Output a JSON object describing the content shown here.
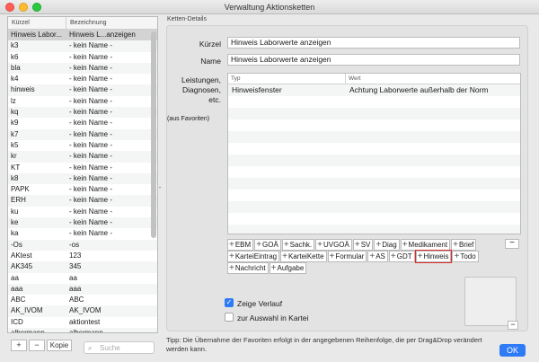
{
  "window": {
    "title": "Verwaltung Aktionsketten"
  },
  "list": {
    "columns": [
      "Kürzel",
      "Bezeichnung"
    ],
    "rows": [
      [
        "Hinweis Labor...",
        "Hinweis L...anzeigen"
      ],
      [
        "k3",
        "- kein Name -"
      ],
      [
        "k6",
        "- kein Name -"
      ],
      [
        "bla",
        "- kein Name -"
      ],
      [
        "k4",
        "- kein Name -"
      ],
      [
        "hinweis",
        "- kein Name -"
      ],
      [
        "lz",
        "- kein Name -"
      ],
      [
        "kq",
        "- kein Name -"
      ],
      [
        "k9",
        "- kein Name -"
      ],
      [
        "k7",
        "- kein Name -"
      ],
      [
        "k5",
        "- kein Name -"
      ],
      [
        "kr",
        "- kein Name -"
      ],
      [
        "KT",
        "- kein Name -"
      ],
      [
        "k8",
        "- kein Name -"
      ],
      [
        "PAPK",
        "- kein Name -"
      ],
      [
        "ERH",
        "- kein Name -"
      ],
      [
        "ku",
        "- kein Name -"
      ],
      [
        "ke",
        "- kein Name -"
      ],
      [
        "ka",
        "- kein Name -"
      ],
      [
        "-Os",
        "-os"
      ],
      [
        "AKtest",
        "123"
      ],
      [
        "AK345",
        "345"
      ],
      [
        "aa",
        "aa"
      ],
      [
        "aaa",
        "aaa"
      ],
      [
        "ABC",
        "ABC"
      ],
      [
        "AK_IVOM",
        "AK_IVOM"
      ],
      [
        "ICD",
        "aktiontest"
      ],
      [
        "albermann",
        "albermann"
      ]
    ],
    "add_label": "+",
    "remove_label": "−",
    "copy_label": "Kopie",
    "search_placeholder": "Suche"
  },
  "details": {
    "group_title": "Ketten-Details",
    "kuerzel_label": "Kürzel",
    "kuerzel_value": "Hinweis Laborwerte anzeigen",
    "name_label": "Name",
    "name_value": "Hinweis Laborwerte anzeigen",
    "leistungen_label": "Leistungen, Diagnosen, etc.",
    "aus_favoriten_label": "(aus Favoriten)",
    "table": {
      "columns": [
        "Typ",
        "Wert"
      ],
      "rows": [
        [
          "Hinweisfenster",
          "Achtung Laborwerte außerhalb der Norm"
        ]
      ]
    },
    "buttons": [
      [
        "EBM",
        "GOÄ",
        "Sachk.",
        "UVGOÄ",
        "SV",
        "Diag",
        "Medikament",
        "Brief"
      ],
      [
        "KarteiEintrag",
        "KarteiKette",
        "Formular",
        "AS",
        "GDT",
        "Hinweis",
        "Todo"
      ],
      [
        "Nachricht",
        "Aufgabe"
      ]
    ],
    "highlighted_button": "Hinweis",
    "zeige_verlauf_label": "Zeige Verlauf",
    "zeige_verlauf_checked": true,
    "zur_auswahl_label": "zur Auswahl in Kartei",
    "zur_auswahl_checked": false
  },
  "footer": {
    "tip": "Tipp: Die Übernahme der Favoriten erfolgt in der angegebenen Reihenfolge, die per Drag&Drop verändert werden kann.",
    "ok_label": "OK"
  },
  "colors": {
    "accent": "#2f7bf5",
    "highlight": "#e02a2a",
    "selected_row": "#d3d3d3"
  }
}
